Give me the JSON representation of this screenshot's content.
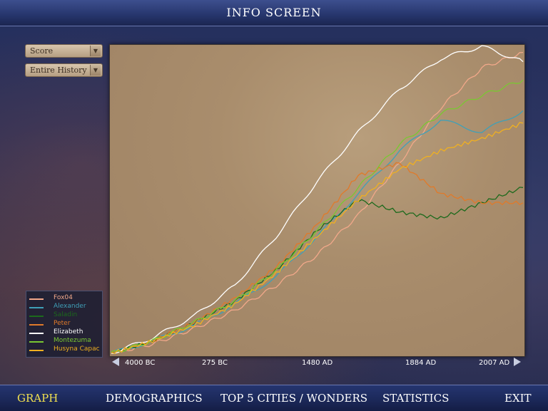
{
  "window": {
    "title": "INFO SCREEN"
  },
  "controls": {
    "graph_type": "Score",
    "time_range": "Entire History"
  },
  "nav": {
    "graph": "GRAPH",
    "demographics": "DEMOGRAPHICS",
    "top5": "TOP 5 CITIES / WONDERS",
    "statistics": "STATISTICS",
    "exit": "EXIT",
    "active": "graph"
  },
  "chart_data": {
    "type": "line",
    "title": "",
    "xlabel": "",
    "ylabel": "",
    "x_ticks": [
      "4000 BC",
      "275 BC",
      "1480 AD",
      "1884 AD",
      "2007 AD"
    ],
    "grid": false,
    "legend_position": "bottom-left",
    "series": [
      {
        "name": "Fox04",
        "color": "#f2a88a",
        "values": [
          0,
          3,
          8,
          14,
          22,
          32,
          45,
          62,
          80,
          93,
          98
        ]
      },
      {
        "name": "Alexander",
        "color": "#3fa0b8",
        "values": [
          0,
          4,
          9,
          16,
          25,
          38,
          52,
          66,
          76,
          72,
          79
        ]
      },
      {
        "name": "Saladin",
        "color": "#1c6a1c",
        "values": [
          0,
          4,
          10,
          17,
          27,
          40,
          50,
          46,
          44,
          49,
          54
        ]
      },
      {
        "name": "Peter",
        "color": "#e07a2a",
        "values": [
          0,
          4,
          10,
          18,
          28,
          42,
          58,
          62,
          52,
          49,
          49
        ]
      },
      {
        "name": "Elizabeth",
        "color": "#ffffff",
        "values": [
          0,
          5,
          12,
          22,
          38,
          56,
          72,
          86,
          96,
          100,
          95
        ]
      },
      {
        "name": "Montezuma",
        "color": "#7ac832",
        "values": [
          0,
          4,
          10,
          17,
          27,
          40,
          54,
          68,
          78,
          84,
          89
        ]
      },
      {
        "name": "Husyna Capac",
        "color": "#f0b020",
        "values": [
          0,
          4,
          9,
          16,
          26,
          38,
          50,
          60,
          66,
          70,
          75
        ]
      }
    ]
  }
}
